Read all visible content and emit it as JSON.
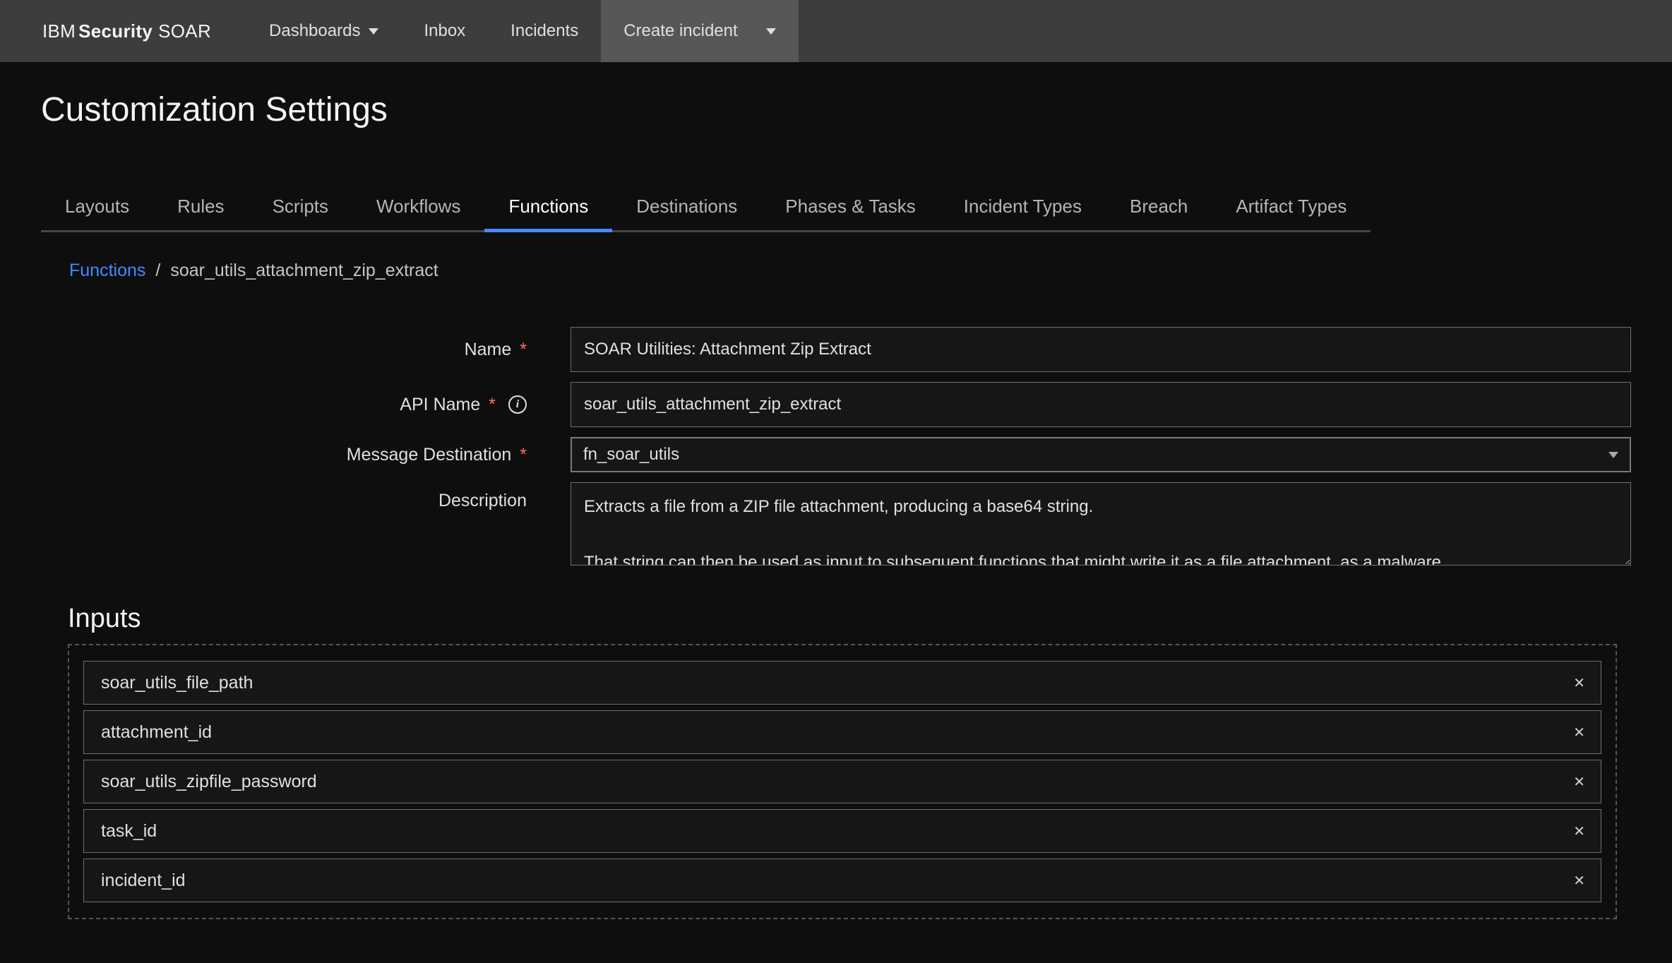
{
  "brand": {
    "prefix": "IBM",
    "bold": "Security",
    "suffix": "SOAR"
  },
  "topnav": {
    "dashboards": "Dashboards",
    "inbox": "Inbox",
    "incidents": "Incidents",
    "create": "Create incident"
  },
  "page_title": "Customization Settings",
  "tabs": {
    "layouts": "Layouts",
    "rules": "Rules",
    "scripts": "Scripts",
    "workflows": "Workflows",
    "functions": "Functions",
    "destinations": "Destinations",
    "phases": "Phases & Tasks",
    "incident_types": "Incident Types",
    "breach": "Breach",
    "artifact_types": "Artifact Types"
  },
  "breadcrumb": {
    "root": "Functions",
    "sep": "/",
    "leaf": "soar_utils_attachment_zip_extract"
  },
  "form": {
    "name_label": "Name",
    "name_value": "SOAR Utilities: Attachment Zip Extract",
    "api_label": "API Name",
    "api_value": "soar_utils_attachment_zip_extract",
    "msgdest_label": "Message Destination",
    "msgdest_value": "fn_soar_utils",
    "desc_label": "Description",
    "desc_value": "Extracts a file from a ZIP file attachment, producing a base64 string.\n\nThat string can then be used as input to subsequent functions that might write it as a file attachment, as a malware"
  },
  "inputs": {
    "header": "Inputs",
    "items": [
      "soar_utils_file_path",
      "attachment_id",
      "soar_utils_zipfile_password",
      "task_id",
      "incident_id"
    ]
  }
}
